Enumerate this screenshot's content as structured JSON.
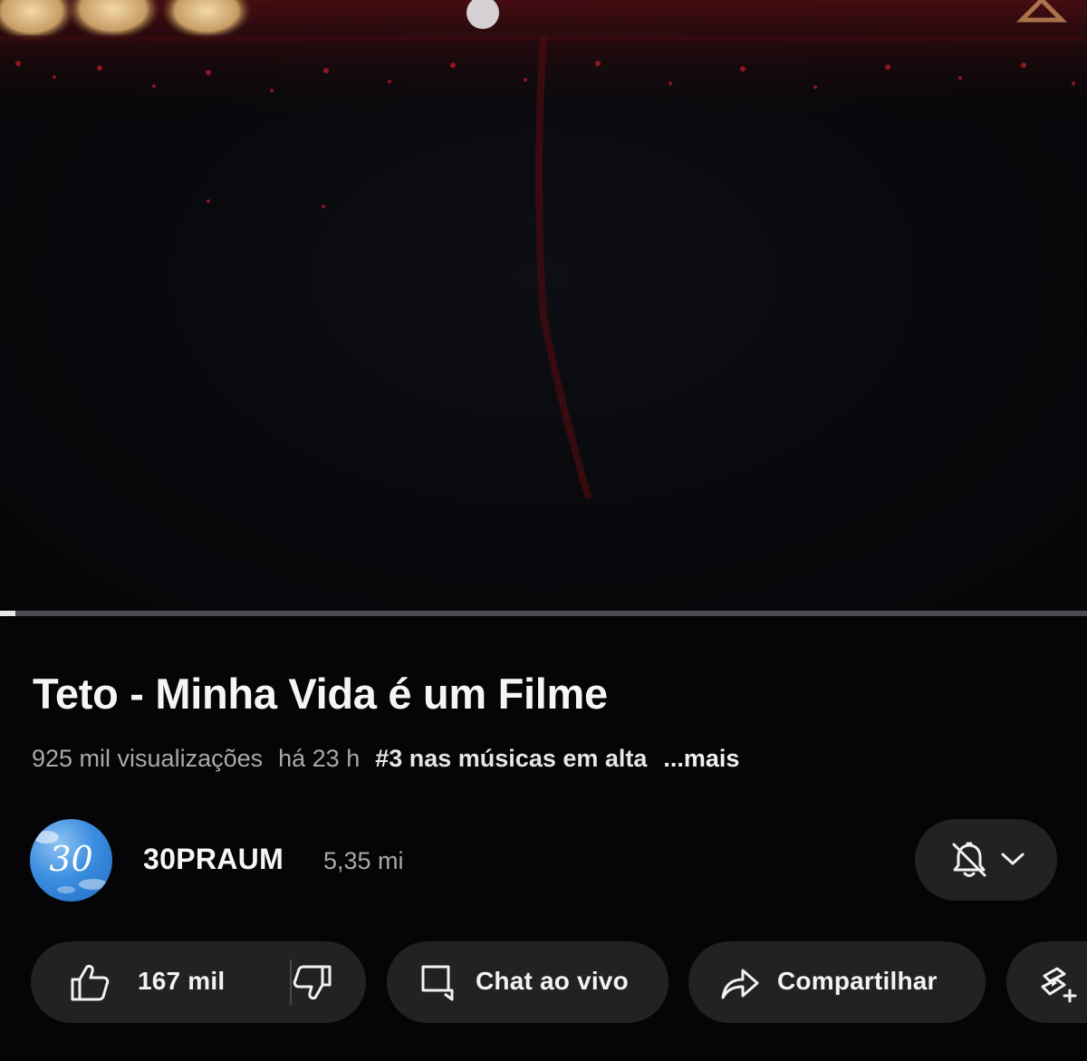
{
  "video": {
    "progress_fraction": 0.014
  },
  "title": "Teto - Minha Vida é um Filme",
  "meta": {
    "views": "925 mil visualizações",
    "time_ago": "há 23 h",
    "trending": "#3 nas músicas em alta",
    "more": "...mais"
  },
  "channel": {
    "avatar_text": "30",
    "name": "30PRAUM",
    "subscribers": "5,35 mi",
    "notification_icon": "bell-off-icon",
    "dropdown_icon": "chevron-down-icon"
  },
  "actions": {
    "like_count": "167 mil",
    "like_icon": "thumbs-up-icon",
    "dislike_icon": "thumbs-down-icon",
    "chat_label": "Chat ao vivo",
    "chat_icon": "chat-icon",
    "share_label": "Compartilhar",
    "share_icon": "share-icon",
    "remix_icon": "remix-icon"
  },
  "colors": {
    "background": "#050507",
    "pill": "#222225",
    "text_primary": "#f1f1f1",
    "text_secondary": "#a9a9a9",
    "avatar_blue": "#3b8ee0"
  }
}
